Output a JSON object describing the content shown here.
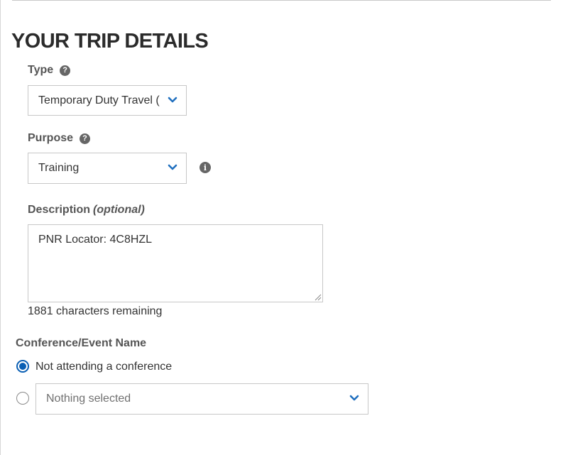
{
  "page": {
    "title": "YOUR TRIP DETAILS"
  },
  "type_field": {
    "label": "Type",
    "selected": "Temporary Duty Travel (",
    "help_icon": "question-circle-icon",
    "dropdown_icon": "chevron-down-icon"
  },
  "purpose_field": {
    "label": "Purpose",
    "selected": "Training",
    "help_icon": "question-circle-icon",
    "info_icon": "info-circle-icon",
    "dropdown_icon": "chevron-down-icon"
  },
  "description_field": {
    "label": "Description",
    "optional_label": "(optional)",
    "value": "PNR Locator: 4C8HZL",
    "chars_remaining": "1881 characters remaining"
  },
  "conference": {
    "label": "Conference/Event Name",
    "options": [
      {
        "label": "Not attending a conference",
        "checked": true
      },
      {
        "label": "",
        "checked": false
      }
    ],
    "select_placeholder": "Nothing selected"
  },
  "colors": {
    "accent": "#0a5fb4",
    "chevron": "#1f6fbf",
    "border": "#c7c7c7",
    "label_text": "#555555"
  }
}
